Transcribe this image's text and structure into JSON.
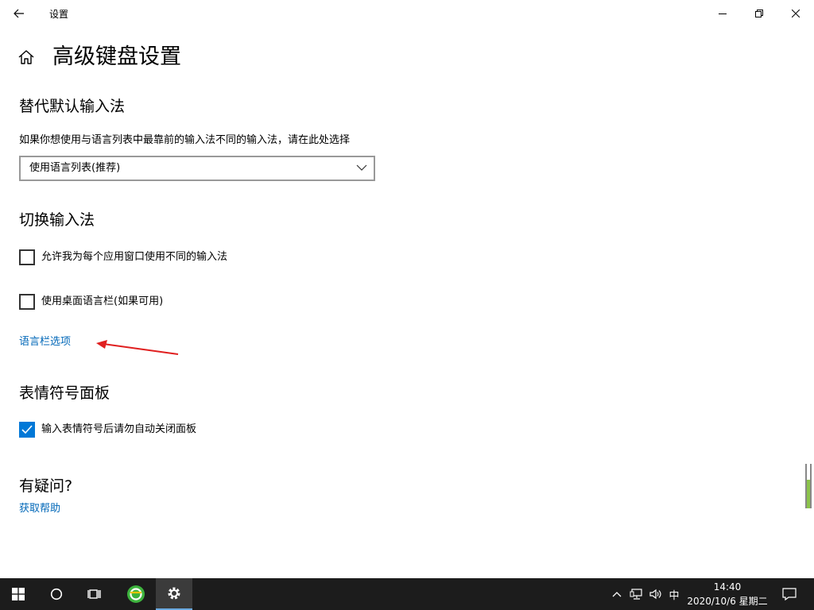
{
  "window": {
    "title": "设置"
  },
  "page": {
    "title": "高级键盘设置"
  },
  "sections": {
    "default_input": {
      "title": "替代默认输入法",
      "description": "如果你想使用与语言列表中最靠前的输入法不同的输入法，请在此处选择",
      "dropdown_value": "使用语言列表(推荐)"
    },
    "switch_input": {
      "title": "切换输入法",
      "checkbox_per_app": {
        "label": "允许我为每个应用窗口使用不同的输入法",
        "checked": false
      },
      "checkbox_langbar": {
        "label": "使用桌面语言栏(如果可用)",
        "checked": false
      },
      "link_langbar_options": "语言栏选项"
    },
    "emoji_panel": {
      "title": "表情符号面板",
      "checkbox_autoclose": {
        "label": "输入表情符号后请勿自动关闭面板",
        "checked": true
      }
    },
    "help": {
      "title": "有疑问?",
      "link_get_help": "获取帮助"
    }
  },
  "taskbar": {
    "ime_indicator": "中",
    "time": "14:40",
    "date": "2020/10/6 星期二"
  },
  "colors": {
    "accent": "#0078d7",
    "link": "#0067b8",
    "annotation_arrow": "#e02020",
    "taskbar": "#1c1c1c"
  },
  "icons": {
    "back": "back-arrow-icon",
    "home": "home-icon",
    "chevron": "chevron-down-icon",
    "start": "windows-logo-icon",
    "search": "search-circle-icon",
    "taskview": "task-view-icon",
    "app360": "360-browser-icon",
    "settings": "gear-icon",
    "tray_up": "chevron-up-icon",
    "network": "network-icon",
    "volume": "volume-icon",
    "notifications": "notification-icon"
  }
}
